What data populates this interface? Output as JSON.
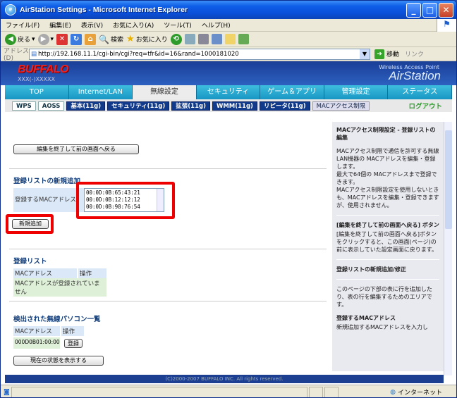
{
  "window": {
    "title": "AirStation Settings - Microsoft Internet Explorer"
  },
  "menu": [
    "ファイル(F)",
    "編集(E)",
    "表示(V)",
    "お気に入り(A)",
    "ツール(T)",
    "ヘルプ(H)"
  ],
  "toolbar": {
    "back": "戻る",
    "search": "検索",
    "favorites": "お気に入り"
  },
  "address": {
    "label": "アドレス(D)",
    "url": "http://192.168.11.1/cgi-bin/cgi?req=tfr&id=16&rand=1000181020",
    "go": "移動",
    "links": "リンク"
  },
  "header": {
    "brand": "BUFFALO",
    "brand_sub": "XXX(-)XXXXX",
    "wap": "Wireless Access Point",
    "product": "AirStation"
  },
  "tabs": [
    "TOP",
    "Internet/LAN",
    "無線設定",
    "セキュリティ",
    "ゲーム＆アプリ",
    "管理設定",
    "ステータス"
  ],
  "subnav": [
    "WPS",
    "AOSS",
    "基本(11g)",
    "セキュリティ(11g)",
    "拡張(11g)",
    "WMM(11g)",
    "リピータ(11g)",
    "MACアクセス制限"
  ],
  "logout": "ログアウト",
  "main": {
    "back_button": "編集を終了して前の画面へ戻る",
    "add_section": "登録リストの新規追加",
    "mac_label": "登録するMACアドレス",
    "mac_values": "00:0D:0B:65:43:21\n00:0D:0B:12:12:12\n00:0D:0B:98:76:54",
    "add_button": "新規追加",
    "list_section": "登録リスト",
    "list_cols": [
      "MACアドレス",
      "操作"
    ],
    "list_empty": "MACアドレスが登録されていません",
    "detected_section": "検出された無線パソコン一覧",
    "detected_cols": [
      "MACアドレス",
      "操作"
    ],
    "detected_mac": "000D0B01:00:00",
    "register_button": "登録",
    "refresh_button": "現在の状態を表示する"
  },
  "side": {
    "title": "MACアクセス制限設定 - 登録リストの編集",
    "p1": "MACアクセス制限で通信を許可する無線LAN機器の MACアドレスを編集・登録します。",
    "p1b": "最大で64個の MACアドレスまで登録できます。",
    "p1c": "MACアクセス制限設定を使用しないときも、MACアドレスを編集・登録できますが、使用されません。",
    "h2": "[編集を終了して前の画面へ戻る] ボタン",
    "p2": "[編集を終了して前の画面へ戻る]ボタンをクリックすると、この画面(ページ)の前に表示していた設定画面に戻ります。",
    "h3": "登録リストの新規追加/修正",
    "p3": "このページの下部の表に行を追加したり、表の行を編集するためのエリアです。",
    "h4": "登録するMACアドレス",
    "p4": "新規追加するMACアドレスを入力し"
  },
  "footer": "(C)2000-2007 BUFFALO INC. All rights reserved.",
  "status": {
    "zone": "インターネット"
  }
}
